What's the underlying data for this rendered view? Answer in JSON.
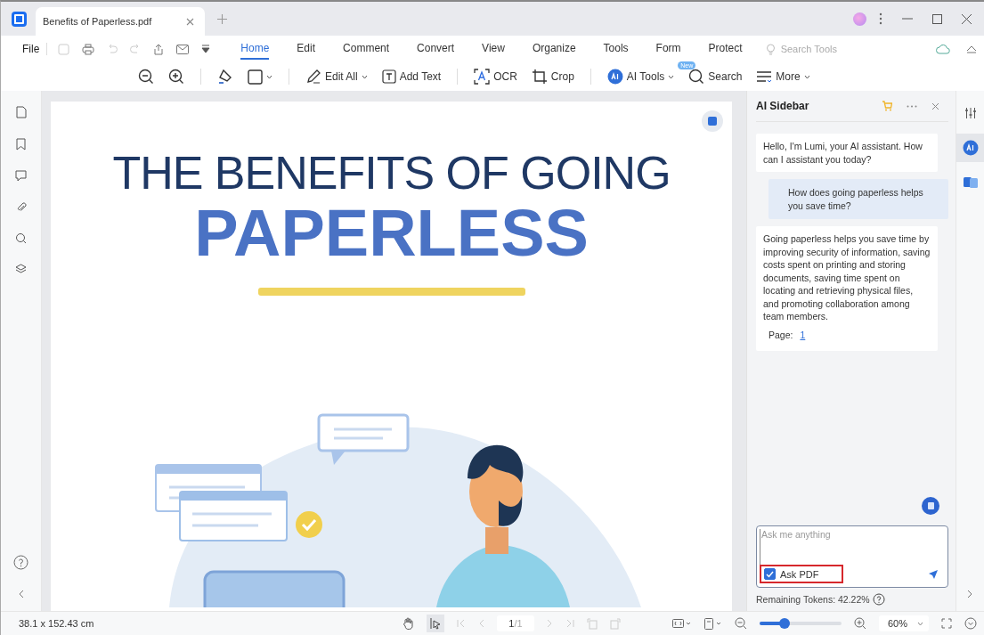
{
  "tab": {
    "title": "Benefits of Paperless.pdf"
  },
  "menu": {
    "file": "File",
    "tabs": [
      {
        "label": "Home",
        "selected": true
      },
      {
        "label": "Edit",
        "selected": false
      },
      {
        "label": "Comment",
        "selected": false
      },
      {
        "label": "Convert",
        "selected": false
      },
      {
        "label": "View",
        "selected": false
      },
      {
        "label": "Organize",
        "selected": false
      },
      {
        "label": "Tools",
        "selected": false
      },
      {
        "label": "Form",
        "selected": false
      },
      {
        "label": "Protect",
        "selected": false
      }
    ],
    "search_tools": {
      "placeholder": "Search Tools"
    }
  },
  "toolbar": [
    {
      "kind": "zoom-out"
    },
    {
      "kind": "zoom-in"
    },
    {
      "kind": "highlight"
    },
    {
      "kind": "shape",
      "dropdown": true
    },
    {
      "kind": "edit",
      "label": "Edit All",
      "dropdown": true
    },
    {
      "kind": "text",
      "label": "Add Text"
    },
    {
      "kind": "ocr",
      "label": "OCR"
    },
    {
      "kind": "crop",
      "label": "Crop"
    },
    {
      "kind": "ai",
      "label": "AI Tools",
      "dropdown": true,
      "badge": "New"
    },
    {
      "kind": "search",
      "label": "Search"
    },
    {
      "kind": "more",
      "label": "More",
      "dropdown": true
    }
  ],
  "document": {
    "heading": "THE BENEFITS OF GOING",
    "headline": "PAPERLESS"
  },
  "ai_sidebar": {
    "title": "AI Sidebar",
    "messages": [
      {
        "kind": "assistant",
        "text": "Hello, I'm Lumi, your AI assistant. How can I assistant you today?"
      },
      {
        "kind": "user",
        "text": "How does going paperless helps you save time?"
      },
      {
        "kind": "assistant",
        "text": "Going paperless helps you save time by improving security of information, saving costs spent on printing and storing documents, saving time spent on locating and retrieving physical files, and promoting collaboration among team members.",
        "page_label": "Page:",
        "page_link": "1"
      }
    ],
    "input": {
      "placeholder": "Ask me anything"
    },
    "ask_pdf": {
      "label": "Ask PDF",
      "checked": true
    },
    "tokens": "Remaining Tokens: 42.22%"
  },
  "status_bar": {
    "dimensions": "38.1 x 152.43 cm",
    "page": "1",
    "page_total": "/1",
    "zoom_slider": {
      "level": 0.3
    },
    "zoom": "60%"
  }
}
